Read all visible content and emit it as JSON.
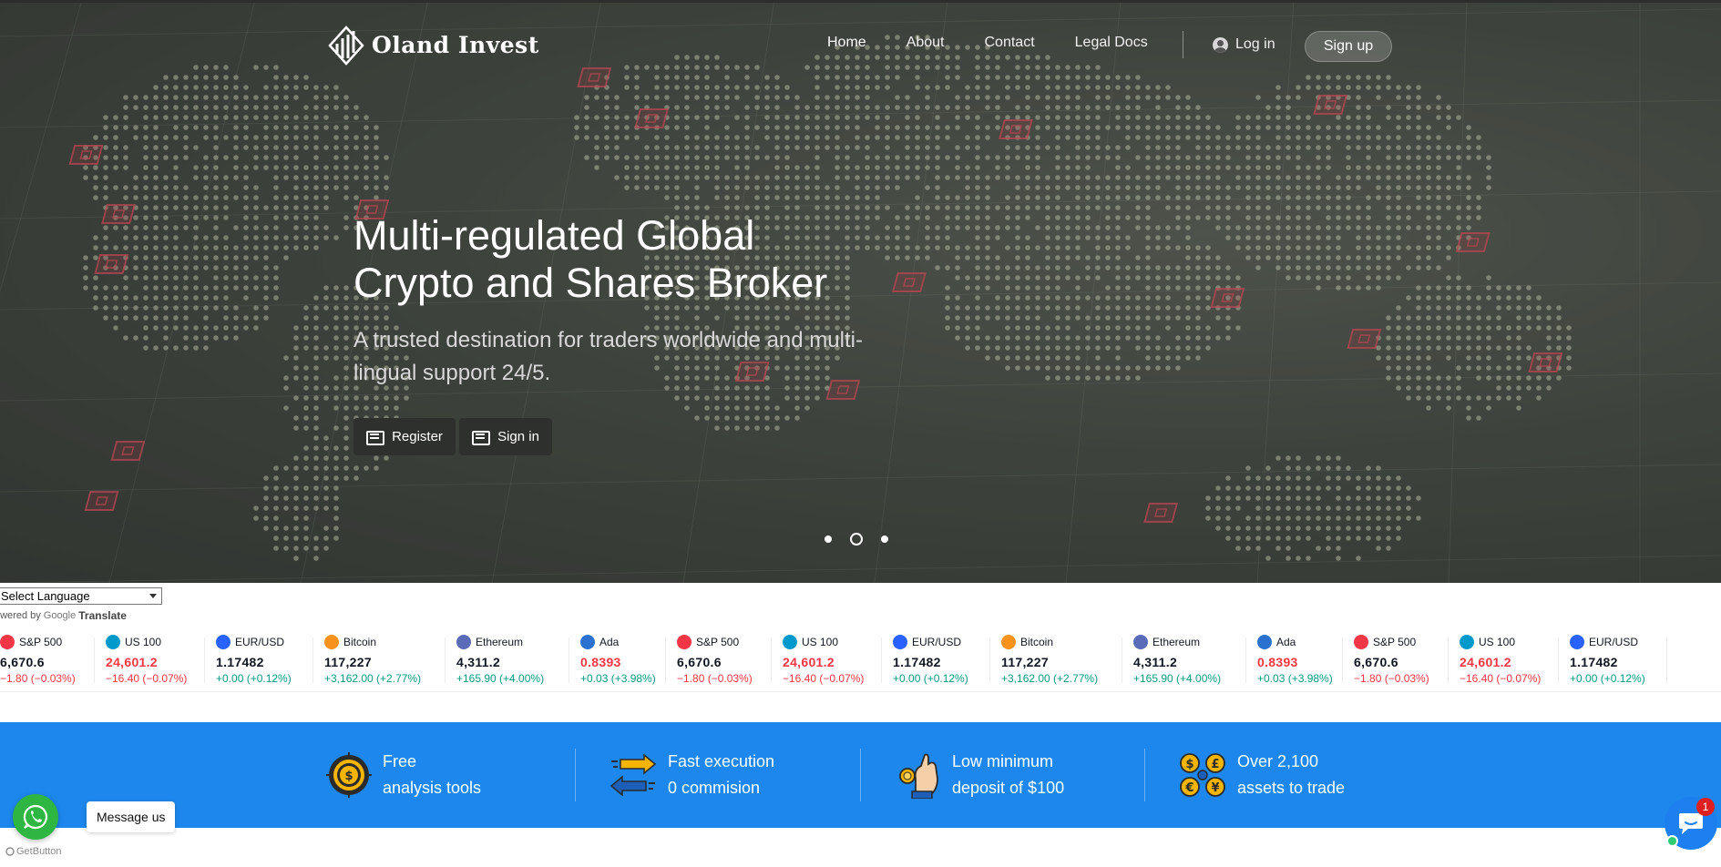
{
  "brand": {
    "name": "Oland Invest"
  },
  "nav": {
    "items": [
      {
        "label": "Home",
        "active": true
      },
      {
        "label": "About",
        "active": false
      },
      {
        "label": "Contact",
        "active": false
      },
      {
        "label": "Legal Docs",
        "active": false
      }
    ],
    "login_label": "Log in",
    "signup_label": "Sign up"
  },
  "hero": {
    "title_line1": "Multi-regulated Global",
    "title_line2": "Crypto and Shares Broker",
    "subtitle": "A trusted destination for traders worldwide and multi-lingual support 24/5.",
    "register_label": "Register",
    "signin_label": "Sign in",
    "slides_count": 3,
    "active_slide": 2
  },
  "language": {
    "select_value": "Select Language",
    "powered_prefix": "owered by",
    "google": "Google",
    "translate": "Translate"
  },
  "ticker": [
    {
      "name": "S&P 500",
      "icon": "sp500-icon",
      "color": "#f23645",
      "value": "6,670.6",
      "change": "−1.80 (−0.03%)",
      "dir": "neg",
      "value_neg": false
    },
    {
      "name": "US 100",
      "icon": "us100-icon",
      "color": "#0099cc",
      "value": "24,601.2",
      "change": "−16.40 (−0.07%)",
      "dir": "neg",
      "value_neg": true
    },
    {
      "name": "EUR/USD",
      "icon": "eurusd-icon",
      "color": "#2962ff",
      "value": "1.17482",
      "change": "+0.00 (+0.12%)",
      "dir": "pos",
      "value_neg": false
    },
    {
      "name": "Bitcoin",
      "icon": "bitcoin-icon",
      "color": "#f7931a",
      "value": "117,227",
      "change": "+3,162.00 (+2.77%)",
      "dir": "pos",
      "value_neg": false
    },
    {
      "name": "Ethereum",
      "icon": "ethereum-icon",
      "color": "#5a6bb8",
      "value": "4,311.2",
      "change": "+165.90 (+4.00%)",
      "dir": "pos",
      "value_neg": false
    },
    {
      "name": "Ada",
      "icon": "ada-icon",
      "color": "#2a71d0",
      "value": "0.8393",
      "change": "+0.03 (+3.98%)",
      "dir": "pos",
      "value_neg": true
    },
    {
      "name": "S&P 500",
      "icon": "sp500-icon",
      "color": "#f23645",
      "value": "6,670.6",
      "change": "−1.80 (−0.03%)",
      "dir": "neg",
      "value_neg": false
    },
    {
      "name": "US 100",
      "icon": "us100-icon",
      "color": "#0099cc",
      "value": "24,601.2",
      "change": "−16.40 (−0.07%)",
      "dir": "neg",
      "value_neg": true
    },
    {
      "name": "EUR/USD",
      "icon": "eurusd-icon",
      "color": "#2962ff",
      "value": "1.17482",
      "change": "+0.00 (+0.12%)",
      "dir": "pos",
      "value_neg": false
    },
    {
      "name": "Bitcoin",
      "icon": "bitcoin-icon",
      "color": "#f7931a",
      "value": "117,227",
      "change": "+3,162.00 (+2.77%)",
      "dir": "pos",
      "value_neg": false
    },
    {
      "name": "Ethereum",
      "icon": "ethereum-icon",
      "color": "#5a6bb8",
      "value": "4,311.2",
      "change": "+165.90 (+4.00%)",
      "dir": "pos",
      "value_neg": false
    },
    {
      "name": "Ada",
      "icon": "ada-icon",
      "color": "#2a71d0",
      "value": "0.8393",
      "change": "+0.03 (+3.98%)",
      "dir": "pos",
      "value_neg": true
    },
    {
      "name": "S&P 500",
      "icon": "sp500-icon",
      "color": "#f23645",
      "value": "6,670.6",
      "change": "−1.80 (−0.03%)",
      "dir": "neg",
      "value_neg": false
    },
    {
      "name": "US 100",
      "icon": "us100-icon",
      "color": "#0099cc",
      "value": "24,601.2",
      "change": "−16.40 (−0.07%)",
      "dir": "neg",
      "value_neg": true
    },
    {
      "name": "EUR/USD",
      "icon": "eurusd-icon",
      "color": "#2962ff",
      "value": "1.17482",
      "change": "+0.00 (+0.12%)",
      "dir": "pos",
      "value_neg": false
    }
  ],
  "features": [
    {
      "icon": "analysis-target-icon",
      "line1": "Free",
      "line2": "analysis tools"
    },
    {
      "icon": "fast-arrows-icon",
      "line1": "Fast execution",
      "line2": "0 commision"
    },
    {
      "icon": "coin-hand-icon",
      "line1": "Low minimum",
      "line2": "deposit of $100"
    },
    {
      "icon": "currency-coins-icon",
      "line1": "Over 2,100",
      "line2": "assets to trade"
    }
  ],
  "widgets": {
    "whatsapp_label": "Message us",
    "getbutton": "GetButton",
    "chat_badge": "1"
  },
  "colors": {
    "accent_blue": "#1d87ed",
    "negative": "#f23645",
    "positive": "#089981",
    "whatsapp": "#2db742"
  }
}
